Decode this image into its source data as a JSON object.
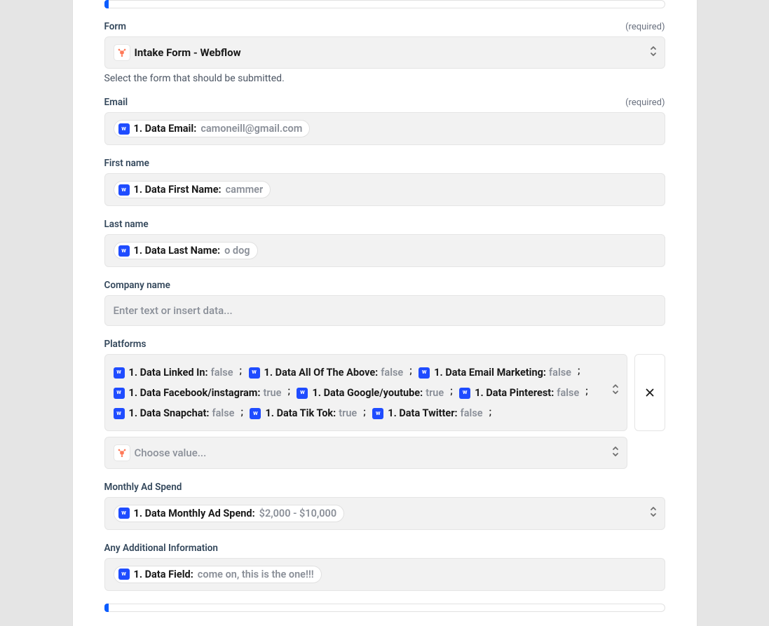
{
  "labels": {
    "form": "Form",
    "email": "Email",
    "first_name": "First name",
    "last_name": "Last name",
    "company_name": "Company name",
    "platforms": "Platforms",
    "monthly_ad_spend": "Monthly Ad Spend",
    "additional_info": "Any Additional Information",
    "required": "(required)"
  },
  "form": {
    "value": "Intake Form - Webflow",
    "helper": "Select the form that should be submitted."
  },
  "email": {
    "token_label": "1. Data Email:",
    "token_value": "camoneill@gmail.com"
  },
  "first_name": {
    "token_label": "1. Data First Name:",
    "token_value": "cammer"
  },
  "last_name": {
    "token_label": "1. Data Last Name:",
    "token_value": "o dog"
  },
  "company_name": {
    "placeholder": "Enter text or insert data..."
  },
  "platforms": {
    "items": [
      {
        "label": "1. Data Linked In:",
        "value": "false"
      },
      {
        "label": "1. Data All Of The Above:",
        "value": "false"
      },
      {
        "label": "1. Data Email Marketing:",
        "value": "false"
      },
      {
        "label": "1. Data Facebook/instagram:",
        "value": "true"
      },
      {
        "label": "1. Data Google/youtube:",
        "value": "true"
      },
      {
        "label": "1. Data Pinterest:",
        "value": "false"
      },
      {
        "label": "1. Data Snapchat:",
        "value": "false"
      },
      {
        "label": "1. Data Tik Tok:",
        "value": "true"
      },
      {
        "label": "1. Data Twitter:",
        "value": "false"
      }
    ],
    "choose_placeholder": "Choose value..."
  },
  "monthly_ad_spend": {
    "token_label": "1. Data Monthly Ad Spend:",
    "token_value": "$2,000 - $10,000"
  },
  "additional_info": {
    "token_label": "1. Data Field:",
    "token_value": "come on, this is the one!!!"
  },
  "icons": {
    "webflow_letter": "w"
  }
}
